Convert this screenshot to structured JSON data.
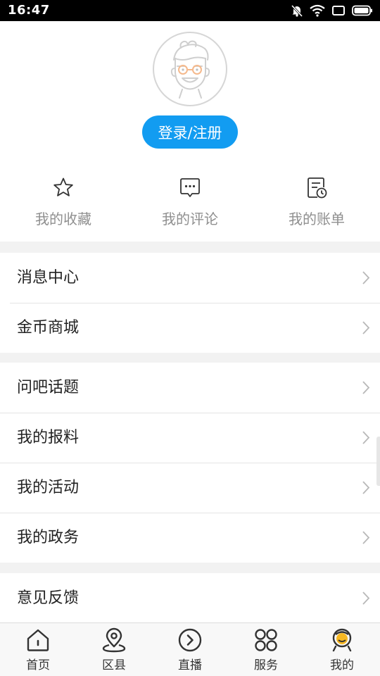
{
  "status_bar": {
    "time": "16:47",
    "icons": [
      "mute-icon",
      "wifi-icon",
      "screen-icon",
      "battery-icon"
    ]
  },
  "profile": {
    "avatar_icon": "cartoon-avatar-icon",
    "login_label": "登录/注册",
    "accent_color": "#129cf1"
  },
  "quick_actions": [
    {
      "label": "我的收藏",
      "icon": "star-icon"
    },
    {
      "label": "我的评论",
      "icon": "comment-icon"
    },
    {
      "label": "我的账单",
      "icon": "bill-icon"
    }
  ],
  "menu_groups": [
    [
      {
        "label": "消息中心"
      },
      {
        "label": "金币商城"
      }
    ],
    [
      {
        "label": "问吧话题"
      },
      {
        "label": "我的报料"
      },
      {
        "label": "我的活动"
      },
      {
        "label": "我的政务"
      }
    ],
    [
      {
        "label": "意见反馈"
      }
    ]
  ],
  "bottom_nav": [
    {
      "label": "首页",
      "icon": "home-icon",
      "active": false
    },
    {
      "label": "区县",
      "icon": "location-icon",
      "active": false
    },
    {
      "label": "直播",
      "icon": "play-circle-icon",
      "active": false
    },
    {
      "label": "服务",
      "icon": "grid-icon",
      "active": false
    },
    {
      "label": "我的",
      "icon": "profile-icon",
      "active": true
    }
  ]
}
